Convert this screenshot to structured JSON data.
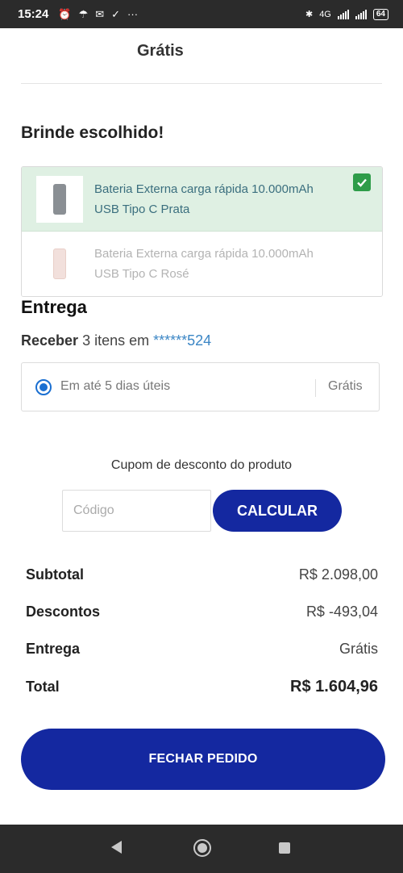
{
  "status_bar": {
    "time": "15:24",
    "left_icons": [
      "alarm-icon",
      "weather-icon",
      "mail-icon",
      "check-icon",
      "more-icon"
    ],
    "network": "4G",
    "battery": "64"
  },
  "top": {
    "shipping_price_header": "Grátis"
  },
  "gift": {
    "title": "Brinde escolhido!",
    "items": [
      {
        "line1": "Bateria Externa carga rápida 10.000mAh",
        "line2": "USB Tipo C Prata",
        "selected": true,
        "color": "#8a8f94"
      },
      {
        "line1": "Bateria Externa carga rápida 10.000mAh",
        "line2": "USB Tipo C Rosé",
        "selected": false,
        "color": "#e9cfc8"
      }
    ]
  },
  "delivery": {
    "title": "Entrega",
    "receive_prefix": "Receber",
    "receive_count": "3 itens em",
    "address": "******524",
    "option_label": "Em até 5 dias úteis",
    "option_price": "Grátis"
  },
  "coupon": {
    "title": "Cupom de desconto do produto",
    "placeholder": "Código",
    "button": "CALCULAR"
  },
  "summary": {
    "subtotal_label": "Subtotal",
    "subtotal_value": "R$ 2.098,00",
    "discount_label": "Descontos",
    "discount_value": "R$ -493,04",
    "shipping_label": "Entrega",
    "shipping_value": "Grátis",
    "total_label": "Total",
    "total_value": "R$ 1.604,96"
  },
  "checkout_button": "FECHAR PEDIDO",
  "colors": {
    "primary": "#1428a0",
    "selected_bg": "#dff0e3",
    "check": "#2e9c49",
    "link": "#3b86c5"
  }
}
